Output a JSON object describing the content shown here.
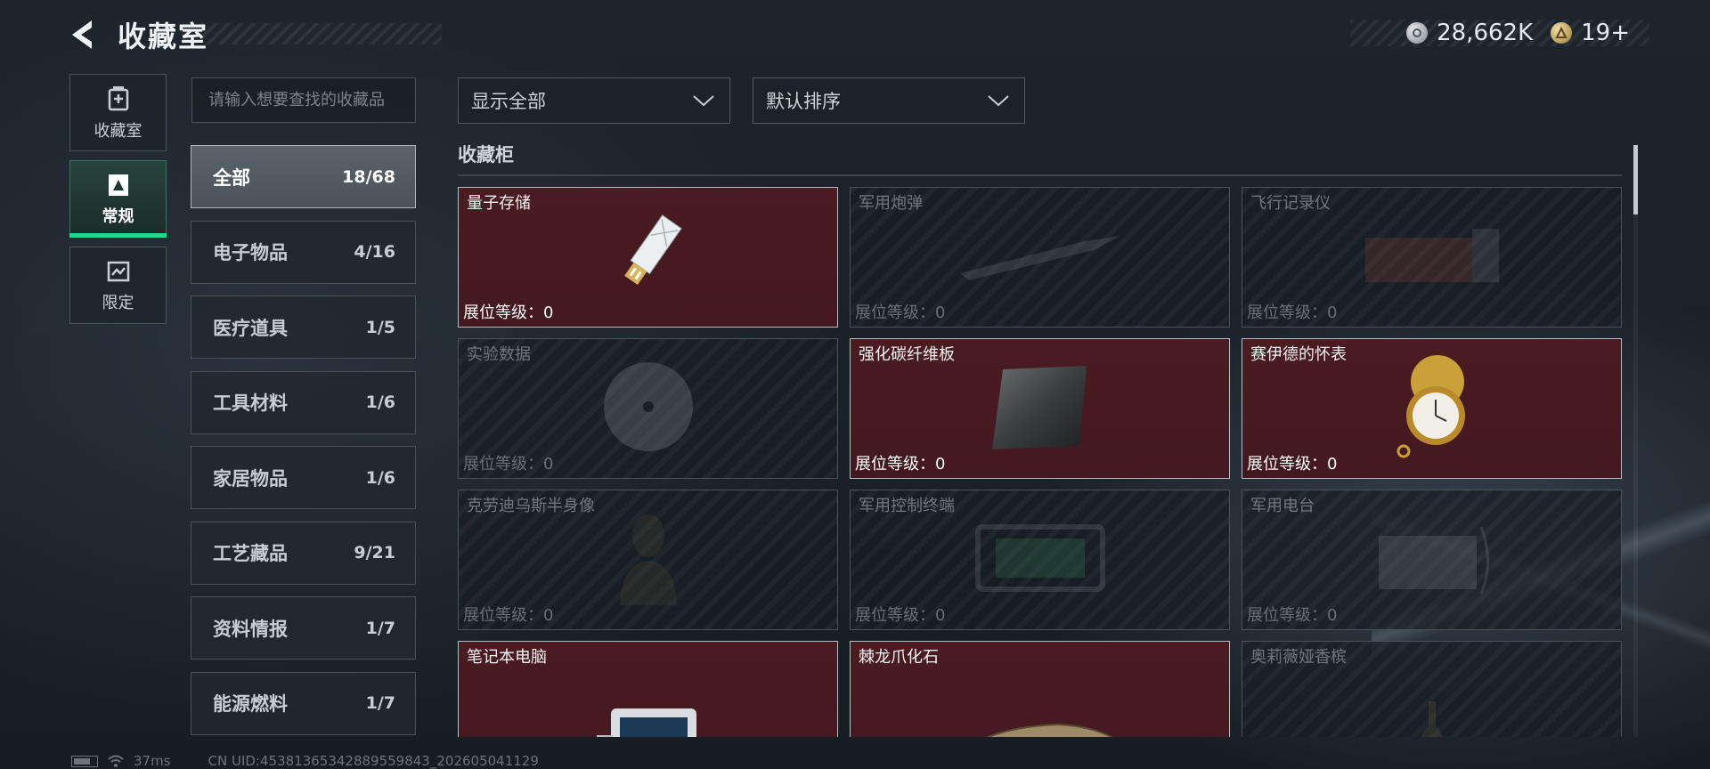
{
  "header": {
    "title": "收藏室",
    "currency": [
      {
        "icon": "silver-coin-icon",
        "value": "28,662K"
      },
      {
        "icon": "gold-token-icon",
        "value": "19+"
      }
    ]
  },
  "leftnav": [
    {
      "label": "收藏室",
      "icon": "collection-room-icon",
      "active": false
    },
    {
      "label": "常规",
      "icon": "regular-icon",
      "active": true
    },
    {
      "label": "限定",
      "icon": "limited-icon",
      "active": false
    }
  ],
  "search": {
    "placeholder": "请输入想要查找的收藏品"
  },
  "categories": [
    {
      "name": "全部",
      "count": "18/68",
      "active": true
    },
    {
      "name": "电子物品",
      "count": "4/16"
    },
    {
      "name": "医疗道具",
      "count": "1/5"
    },
    {
      "name": "工具材料",
      "count": "1/6"
    },
    {
      "name": "家居物品",
      "count": "1/6"
    },
    {
      "name": "工艺藏品",
      "count": "9/21"
    },
    {
      "name": "资料情报",
      "count": "1/7"
    },
    {
      "name": "能源燃料",
      "count": "1/7"
    }
  ],
  "filters": {
    "display": "显示全部",
    "sort": "默认排序"
  },
  "section": {
    "title": "收藏柜"
  },
  "items": [
    {
      "name": "量子存储",
      "level": "展位等级：0",
      "owned": true,
      "icon": "usb-drive-icon"
    },
    {
      "name": "军用炮弹",
      "level": "展位等级：0",
      "owned": false,
      "icon": "shell-icon"
    },
    {
      "name": "飞行记录仪",
      "level": "展位等级：0",
      "owned": false,
      "icon": "flight-recorder-icon"
    },
    {
      "name": "实验数据",
      "level": "展位等级：0",
      "owned": false,
      "icon": "data-disc-icon"
    },
    {
      "name": "强化碳纤维板",
      "level": "展位等级：0",
      "owned": true,
      "icon": "carbon-plate-icon"
    },
    {
      "name": "赛伊德的怀表",
      "level": "展位等级：0",
      "owned": true,
      "icon": "pocket-watch-icon"
    },
    {
      "name": "克劳迪乌斯半身像",
      "level": "展位等级：0",
      "owned": false,
      "icon": "bust-icon"
    },
    {
      "name": "军用控制终端",
      "level": "展位等级：0",
      "owned": false,
      "icon": "terminal-icon"
    },
    {
      "name": "军用电台",
      "level": "展位等级：0",
      "owned": false,
      "icon": "radio-icon"
    },
    {
      "name": "笔记本电脑",
      "level": "",
      "owned": true,
      "icon": "laptop-icon"
    },
    {
      "name": "棘龙爪化石",
      "level": "",
      "owned": true,
      "icon": "claw-fossil-icon"
    },
    {
      "name": "奥莉薇娅香槟",
      "level": "",
      "owned": false,
      "icon": "champagne-icon"
    }
  ],
  "footer": {
    "ping": "37ms",
    "uid": "CN UID:453813653428895598​43_202605041129"
  }
}
